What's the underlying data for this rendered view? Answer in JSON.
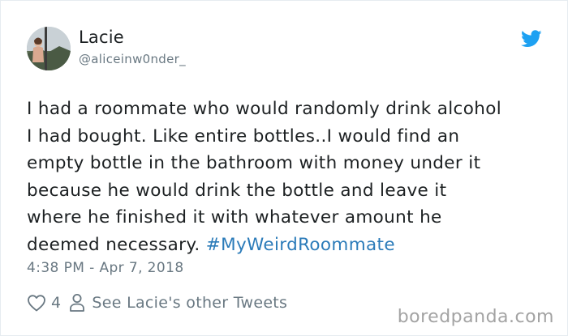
{
  "author": {
    "display_name": "Lacie",
    "screen_name": "@aliceinw0nder_",
    "avatar_icon": "profile-photo"
  },
  "brand_icon": "twitter-bird-icon",
  "brand_color": "#1da1f2",
  "tweet": {
    "text_before_hashtag": "I had a roommate who would randomly drink alcohol\nI had bought. Like entire bottles..I would find an\nempty bottle in the bathroom with money under it\nbecause he would drink the bottle and leave it\nwhere he finished it with whatever amount he\ndeemed necessary. ",
    "hashtag": "#MyWeirdRoommate",
    "hashtag_color": "#2b7bb9",
    "timestamp": "4:38 PM - Apr 7, 2018"
  },
  "actions": {
    "like_icon": "heart-icon",
    "like_count": "4",
    "profile_icon": "person-icon",
    "other_tweets_label": "See Lacie's other Tweets"
  },
  "watermark": "boredpanda.com"
}
